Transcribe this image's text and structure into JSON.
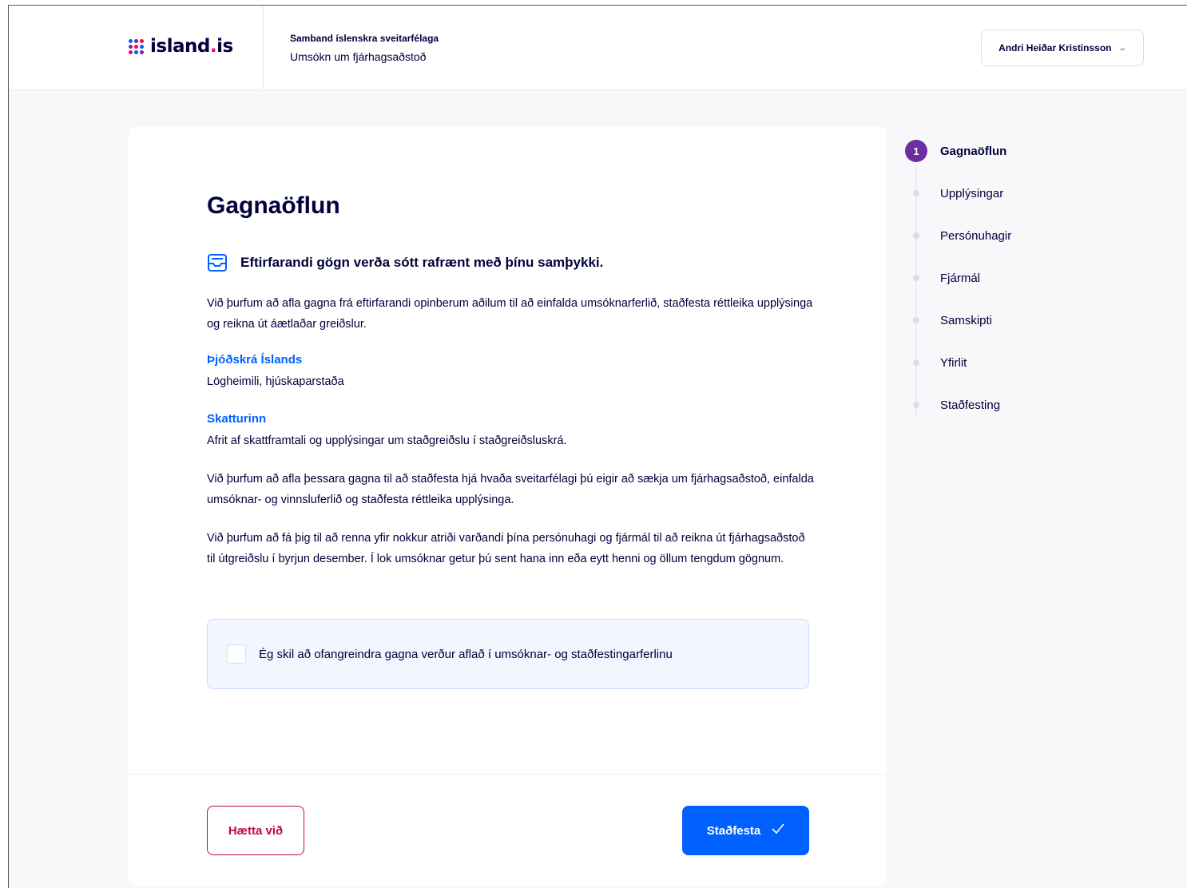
{
  "header": {
    "logo_text": "island",
    "logo_tld": ".is",
    "org_name": "Samband íslenskra sveitarfélaga",
    "app_name": "Umsókn um fjárhagsaðstoð",
    "user_name": "Andri Heiðar Kristinsson",
    "user_menu_icon": "chevron-down-icon"
  },
  "main": {
    "title": "Gagnaöflun",
    "intro_icon": "inbox-tray-icon",
    "intro": "Eftirfarandi gögn verða sótt rafrænt með þínu samþykki.",
    "para1": "Við þurfum að afla gagna frá eftirfarandi opinberum aðilum til að einfalda umsóknarferlið, staðfesta réttleika upplýsinga og reikna út áætlaðar greiðslur.",
    "source1_title": "Þjóðskrá Íslands",
    "source1_desc": "Lögheimili, hjúskaparstaða",
    "source2_title": "Skatturinn",
    "source2_desc": "Afrit af skattframtali og upplýsingar um staðgreiðslu í staðgreiðsluskrá.",
    "para2": "Við þurfum að afla þessara gagna til að staðfesta hjá hvaða sveitarfélagi þú eigir að sækja um fjárhagsaðstoð, einfalda umsóknar- og vinnsluferlið og staðfesta réttleika upplýsinga.",
    "para3": "Við þurfum að fá þig til að renna yfir nokkur atriði varðandi þína persónuhagi og fjármál til að reikna út fjárhagsaðstoð til útgreiðslu í byrjun desember. Í lok umsóknar getur þú sent hana inn eða eytt henni og öllum tengdum gögnum.",
    "checkbox_label": "Ég skil að ofangreindra gagna verður aflað í umsóknar- og staðfestingarferlinu",
    "checkbox_checked": false,
    "cancel_label": "Hætta við",
    "confirm_label": "Staðfesta",
    "confirm_icon": "checkmark-icon"
  },
  "stepper": {
    "active_number": "1",
    "steps": [
      {
        "label": "Gagnaöflun",
        "active": true
      },
      {
        "label": "Upplýsingar",
        "active": false
      },
      {
        "label": "Persónuhagir",
        "active": false
      },
      {
        "label": "Fjármál",
        "active": false
      },
      {
        "label": "Samskipti",
        "active": false
      },
      {
        "label": "Yfirlit",
        "active": false
      },
      {
        "label": "Staðfesting",
        "active": false
      }
    ]
  },
  "colors": {
    "primary": "#0061ff",
    "cancel": "#c3073f",
    "stepper_active": "#6a2ea0",
    "text": "#00003c"
  }
}
